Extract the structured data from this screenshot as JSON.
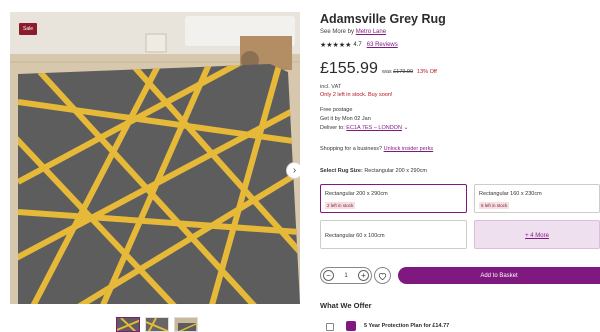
{
  "gallery": {
    "sale_badge": "Sale",
    "next_arrow": "›",
    "thumbnail_count": 3
  },
  "product": {
    "title": "Adamsville Grey Rug",
    "see_more_prefix": "See More by",
    "brand": "Metro Lane",
    "stars": "★★★★★",
    "rating": "4.7",
    "reviews": "63 Reviews",
    "price": "£155.99",
    "was_prefix": "was",
    "was_price": "£179.99",
    "discount": "13% Off",
    "vat": "incl. VAT",
    "stock": "Only 2 left in stock. Buy soon!",
    "postage": "Free postage",
    "delivery_date": "Get it by Mon 02 Jan",
    "deliver_to_prefix": "Deliver to:",
    "deliver_to_location": "EC1A 7ES – LONDON",
    "business_prefix": "Shopping for a business?",
    "business_link": "Unlock insider perks",
    "size_label": "Select Rug Size:",
    "size_selected": "Rectangular 200 x 290cm"
  },
  "size_options": [
    {
      "label": "Rectangular 200 x 290cm",
      "tag": "2 left in stock",
      "selected": true
    },
    {
      "label": "Rectangular 160 x 230cm",
      "tag": "6 left in stock",
      "selected": false
    },
    {
      "label": "Rectangular 60 x 100cm",
      "tag": "",
      "selected": false
    },
    {
      "label": "+ 4 More",
      "tag": "",
      "selected": false
    }
  ],
  "purchase": {
    "minus": "−",
    "quantity": "1",
    "plus": "+",
    "add_to_basket": "Add to Basket"
  },
  "offers": {
    "title": "What We Offer",
    "protection_plan": "5 Year Protection Plan for £14.77"
  },
  "colors": {
    "accent": "#7f187f",
    "sale": "#8b1c2b",
    "rug_grey": "#5e5e5e",
    "rug_yellow": "#e7b938",
    "red_text": "#b5121b"
  }
}
